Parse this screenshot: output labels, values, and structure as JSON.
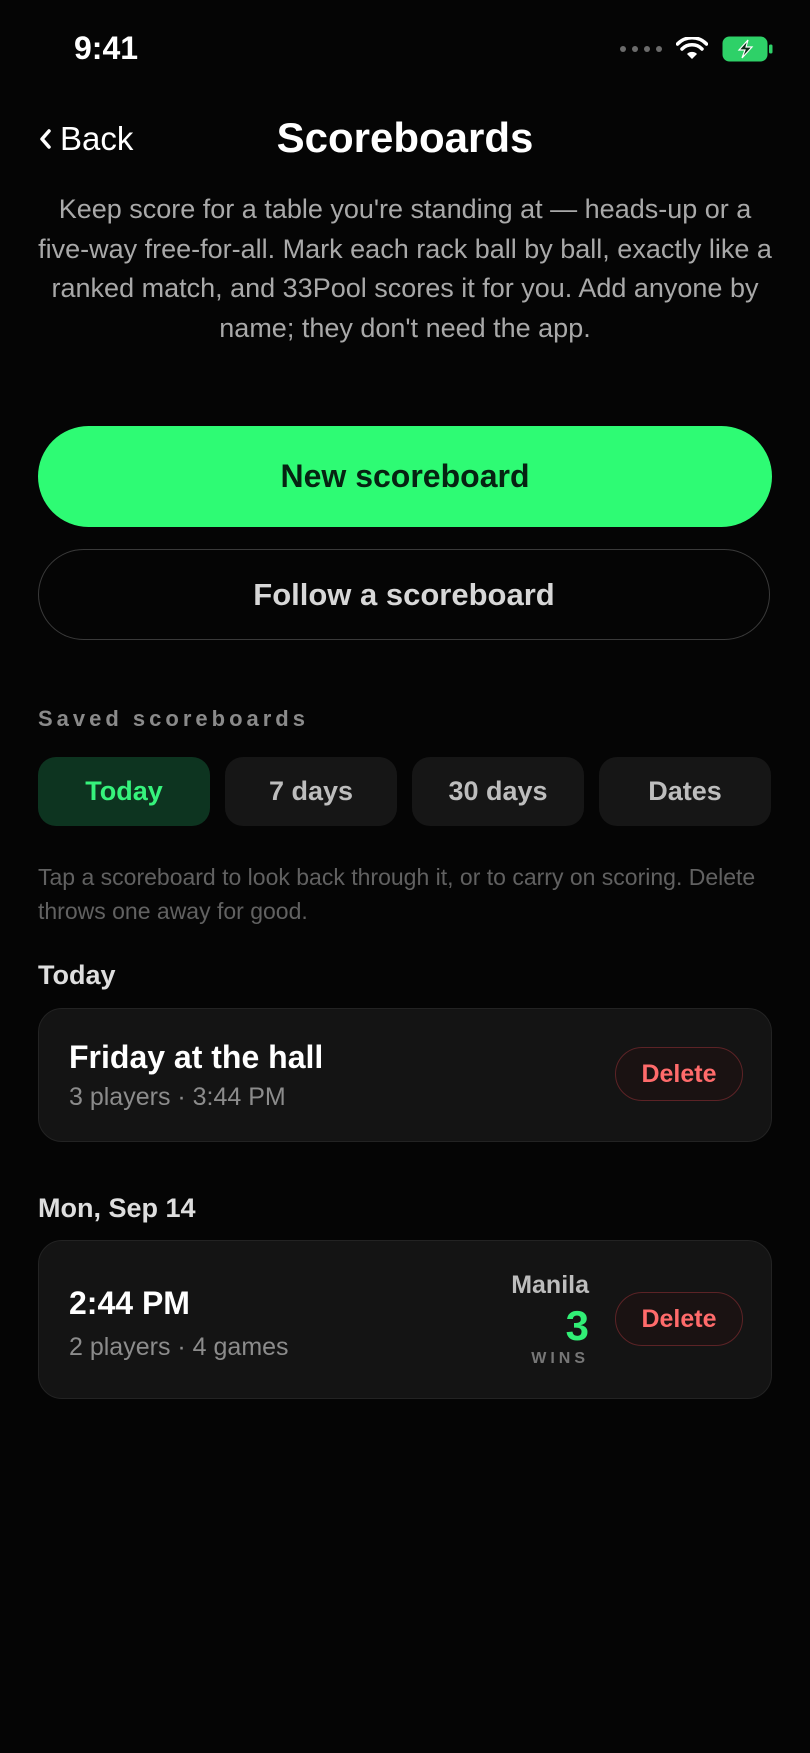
{
  "status_bar": {
    "time": "9:41"
  },
  "nav": {
    "back_label": "Back",
    "title": "Scoreboards"
  },
  "intro": "Keep score for a table you're standing at — heads-up or a five-way free-for-all. Mark each rack ball by ball, exactly like a ranked match, and 33Pool scores it for you. Add anyone by name; they don't need the app.",
  "actions": {
    "new_label": "New scoreboard",
    "follow_label": "Follow a scoreboard"
  },
  "saved": {
    "section_label": "Saved scoreboards",
    "filters": [
      "Today",
      "7 days",
      "30 days",
      "Dates"
    ],
    "active_filter": "Today",
    "hint": "Tap a scoreboard to look back through it, or to carry on scoring. Delete throws one away for good."
  },
  "groups": [
    {
      "heading": "Today",
      "items": [
        {
          "title": "Friday at the hall",
          "subtitle": "3 players · 3:44 PM",
          "delete_label": "Delete"
        }
      ]
    },
    {
      "heading": "Mon, Sep 14",
      "items": [
        {
          "title": "2:44 PM",
          "subtitle": "2 players · 4 games",
          "winner_name": "Manila",
          "winner_score": "3",
          "winner_label": "WINS",
          "delete_label": "Delete"
        }
      ]
    }
  ],
  "colors": {
    "accent": "#2efb74",
    "danger": "#ff6b6b",
    "background": "#050505"
  },
  "icons": {
    "back": "chevron-left-icon",
    "wifi": "wifi-icon",
    "battery": "battery-charging-icon",
    "signal": "signal-dots-icon"
  }
}
